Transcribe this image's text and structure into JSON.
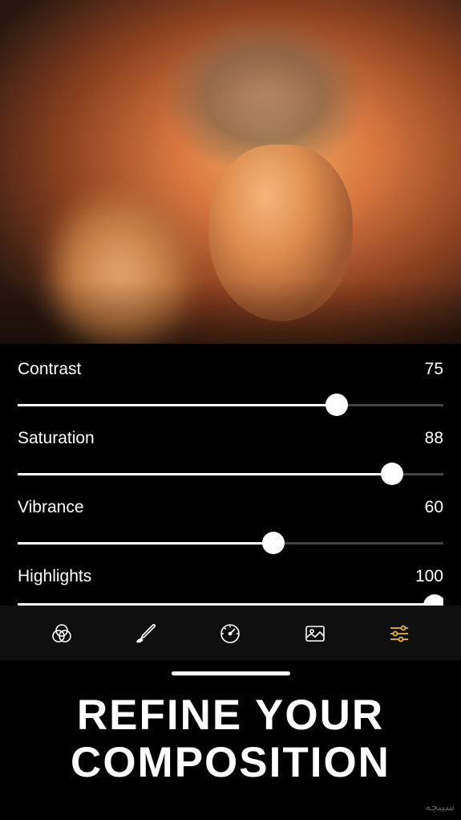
{
  "sliders": [
    {
      "label": "Contrast",
      "value": 75,
      "percent": 75
    },
    {
      "label": "Saturation",
      "value": 88,
      "percent": 88
    },
    {
      "label": "Vibrance",
      "value": 60,
      "percent": 60
    },
    {
      "label": "Highlights",
      "value": 100,
      "percent": 100
    }
  ],
  "toolbar": {
    "items": [
      {
        "name": "filters-icon",
        "active": false
      },
      {
        "name": "brush-icon",
        "active": false
      },
      {
        "name": "speed-icon",
        "active": false
      },
      {
        "name": "image-icon",
        "active": false
      },
      {
        "name": "adjustments-icon",
        "active": true
      }
    ]
  },
  "headline": "REFINE YOUR COMPOSITION",
  "watermark": "سیبچه"
}
